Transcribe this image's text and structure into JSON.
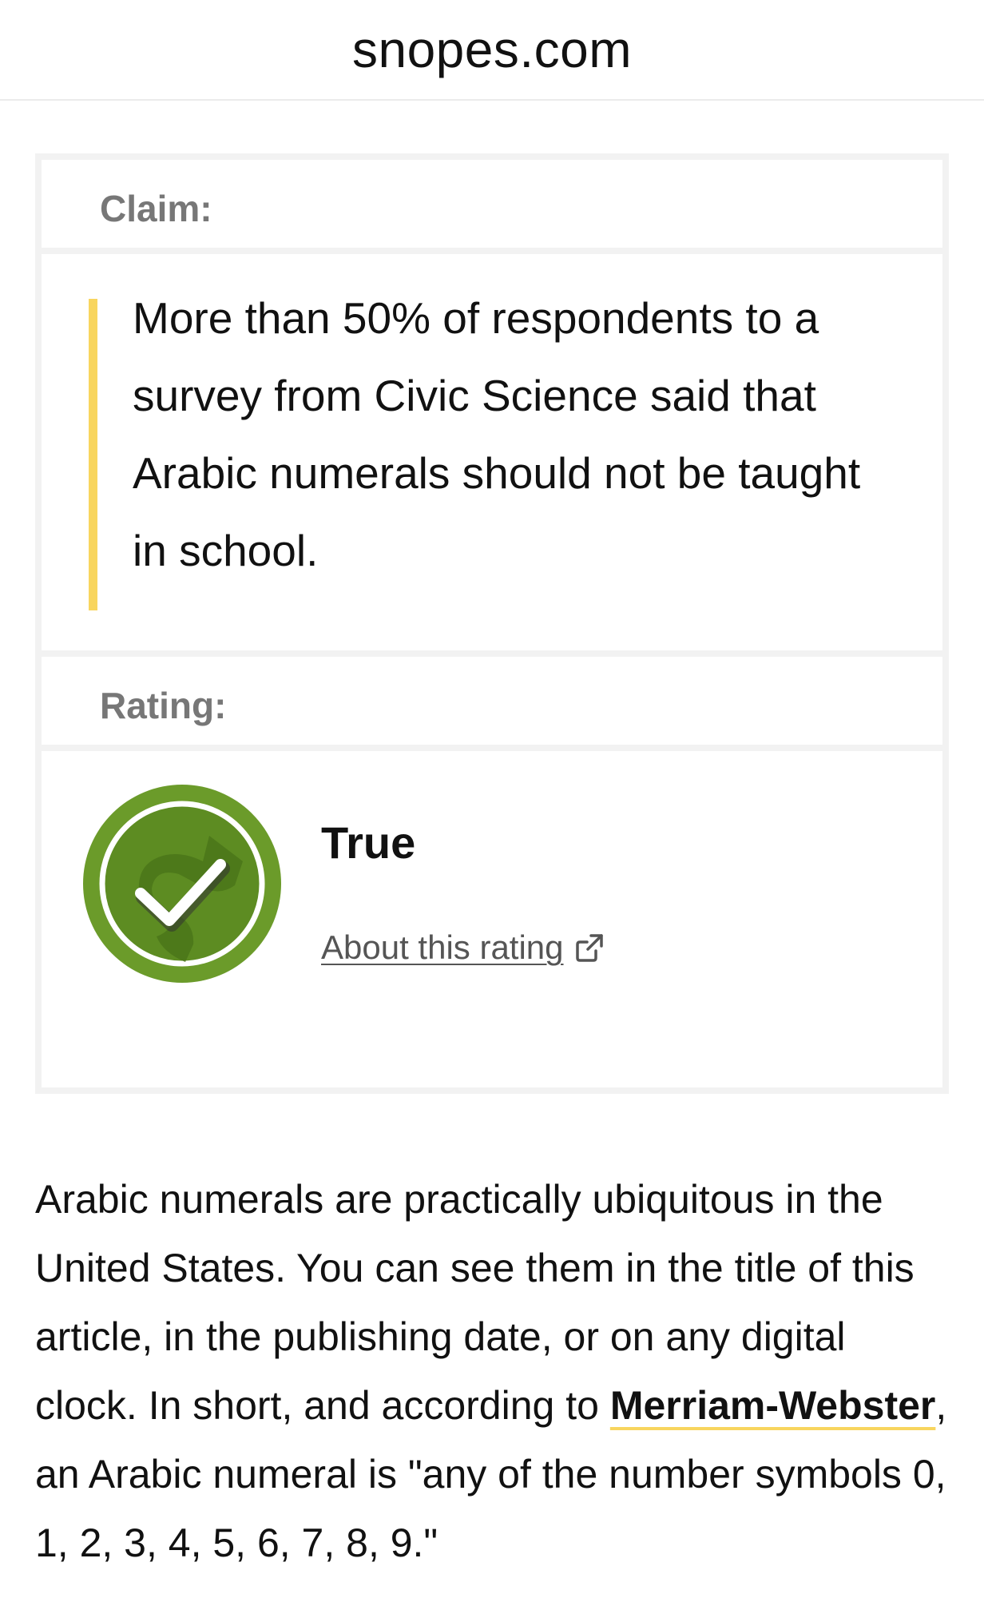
{
  "header": {
    "url": "snopes.com"
  },
  "claim": {
    "label": "Claim:",
    "text": "More than 50% of respondents to a survey from Civic Science said that Arabic numerals should not be taught in school."
  },
  "rating": {
    "label": "Rating:",
    "value": "True",
    "about_link": "About this rating",
    "icon": "true-rating-check-icon",
    "icon_color": "#6b9b2a"
  },
  "article": {
    "p1_before": "Arabic numerals are practically ubiquitous in the United States. You can see them in the title of this article, in the publishing date, or on any digital clock. In short, and according to ",
    "link": "Merriam-Webster",
    "p1_after": ", an Arabic numeral is \"any of the number symbols 0, 1, 2, 3, 4, 5, 6, 7, 8, 9.\""
  },
  "colors": {
    "accent": "#f8d55e",
    "card_border": "#f2f2f2",
    "label_gray": "#777777"
  }
}
